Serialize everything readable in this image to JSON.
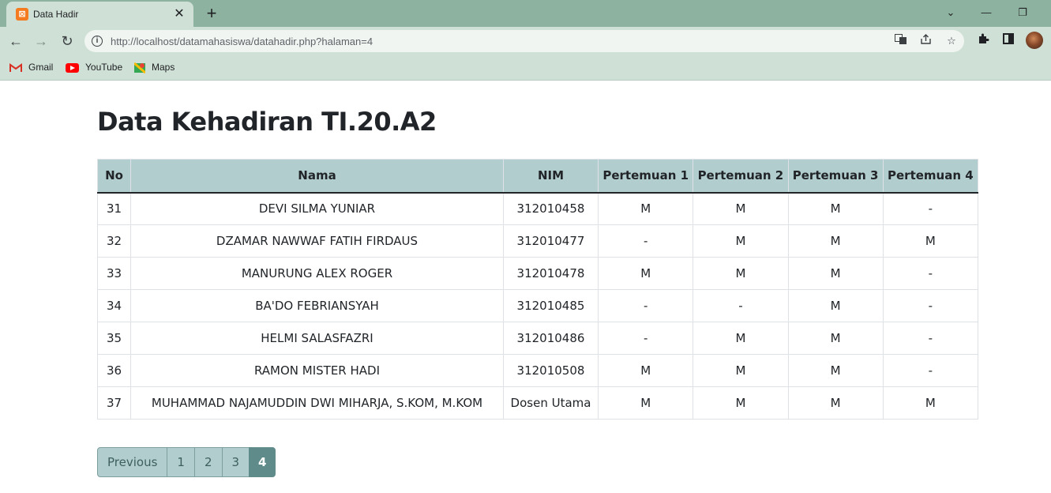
{
  "browser": {
    "tab": {
      "title": "Data Hadir",
      "close": "✕"
    },
    "new_tab": "+",
    "window_controls": {
      "dropdown": "⌄",
      "minimize": "—",
      "restore": "❐"
    },
    "nav": {
      "back": "←",
      "forward": "→",
      "reload": "↻"
    },
    "url": "http://localhost/datamahasiswa/datahadir.php?halaman=4",
    "bookmarks": [
      {
        "label": "Gmail",
        "icon": "gmail-icon"
      },
      {
        "label": "YouTube",
        "icon": "youtube-icon"
      },
      {
        "label": "Maps",
        "icon": "maps-icon"
      }
    ]
  },
  "page": {
    "title": "Data Kehadiran TI.20.A2"
  },
  "table": {
    "headers": [
      "No",
      "Nama",
      "NIM",
      "Pertemuan 1",
      "Pertemuan 2",
      "Pertemuan 3",
      "Pertemuan 4"
    ],
    "rows": [
      [
        "31",
        "DEVI SILMA YUNIAR",
        "312010458",
        "M",
        "M",
        "M",
        "-"
      ],
      [
        "32",
        "DZAMAR NAWWAF FATIH FIRDAUS",
        "312010477",
        "-",
        "M",
        "M",
        "M"
      ],
      [
        "33",
        "MANURUNG ALEX ROGER",
        "312010478",
        "M",
        "M",
        "M",
        "-"
      ],
      [
        "34",
        "BA'DO FEBRIANSYAH",
        "312010485",
        "-",
        "-",
        "M",
        "-"
      ],
      [
        "35",
        "HELMI SALASFAZRI",
        "312010486",
        "-",
        "M",
        "M",
        "-"
      ],
      [
        "36",
        "RAMON MISTER HADI",
        "312010508",
        "M",
        "M",
        "M",
        "-"
      ],
      [
        "37",
        "MUHAMMAD NAJAMUDDIN DWI MIHARJA, S.KOM, M.KOM",
        "Dosen Utama",
        "M",
        "M",
        "M",
        "M"
      ]
    ]
  },
  "pagination": {
    "previous": "Previous",
    "pages": [
      "1",
      "2",
      "3",
      "4"
    ],
    "active": "4"
  }
}
